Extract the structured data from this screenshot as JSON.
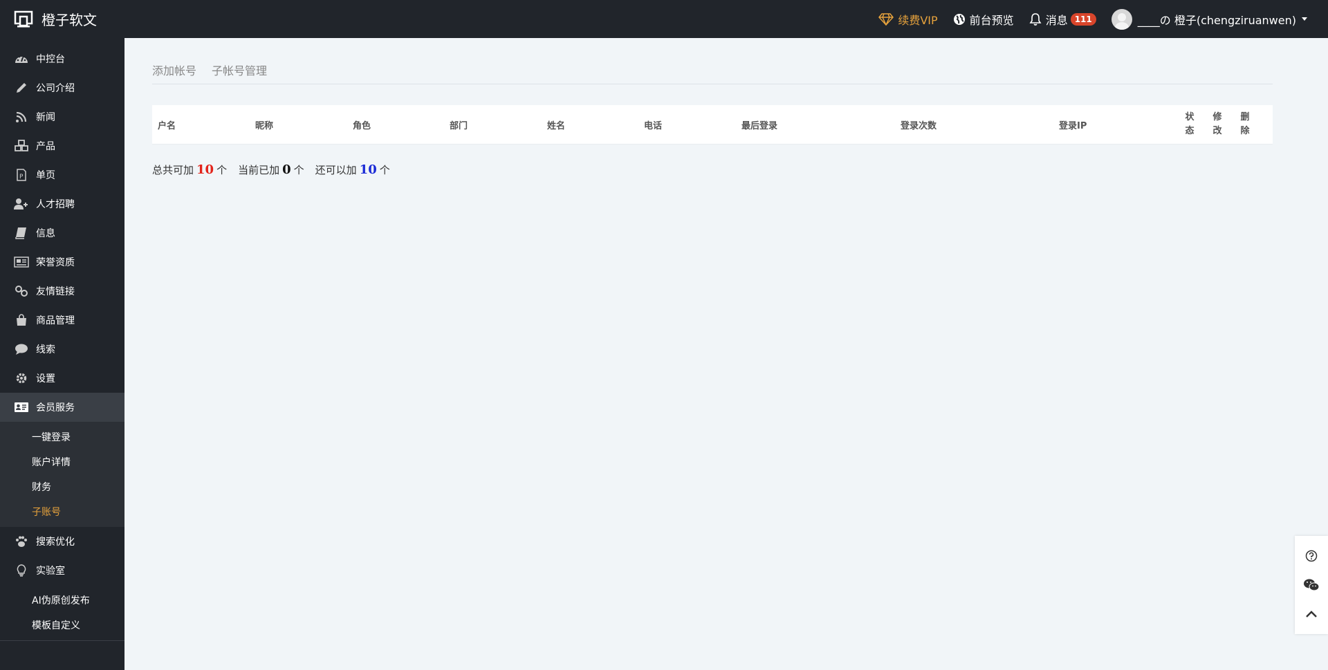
{
  "header": {
    "brand": "橙子软文",
    "vip_label": "续费VIP",
    "preview_label": "前台预览",
    "messages_label": "消息",
    "messages_count": "111",
    "user_name": "____の 橙子(chengziruanwen)"
  },
  "sidebar": {
    "items": [
      {
        "label": "中控台",
        "icon": "dashboard-icon"
      },
      {
        "label": "公司介绍",
        "icon": "pencil-icon"
      },
      {
        "label": "新闻",
        "icon": "rss-icon"
      },
      {
        "label": "产品",
        "icon": "cubes-icon"
      },
      {
        "label": "单页",
        "icon": "page-icon"
      },
      {
        "label": "人才招聘",
        "icon": "user-plus-icon"
      },
      {
        "label": "信息",
        "icon": "book-icon"
      },
      {
        "label": "荣誉资质",
        "icon": "newspaper-icon"
      },
      {
        "label": "友情链接",
        "icon": "link-icon"
      },
      {
        "label": "商品管理",
        "icon": "shopping-bag-icon"
      },
      {
        "label": "线索",
        "icon": "comment-icon"
      },
      {
        "label": "设置",
        "icon": "gear-icon"
      },
      {
        "label": "会员服务",
        "icon": "id-card-icon"
      }
    ],
    "member_sub": [
      "一键登录",
      "账户详情",
      "财务",
      "子账号"
    ],
    "items2": [
      {
        "label": "搜索优化",
        "icon": "paw-icon"
      },
      {
        "label": "实验室",
        "icon": "lightbulb-icon"
      }
    ],
    "lab_sub": [
      "AI伪原创发布",
      "模板自定义"
    ]
  },
  "main": {
    "tabs": [
      "添加帐号",
      "子帐号管理"
    ],
    "columns": [
      "户名",
      "昵称",
      "角色",
      "部门",
      "姓名",
      "电话",
      "最后登录",
      "登录次数",
      "登录IP"
    ],
    "col_status": [
      "状",
      "态"
    ],
    "col_edit": [
      "修",
      "改"
    ],
    "col_delete": [
      "删",
      "除"
    ],
    "summary": {
      "total_label": "总共可加",
      "total": "10",
      "current_label": "当前已加",
      "current": "0",
      "remain_label": "还可以加",
      "remain": "10",
      "unit": "个"
    }
  },
  "colors": {
    "accent": "#e6a23c",
    "sidebar_bg": "#21252b",
    "badge": "#d9452b"
  }
}
